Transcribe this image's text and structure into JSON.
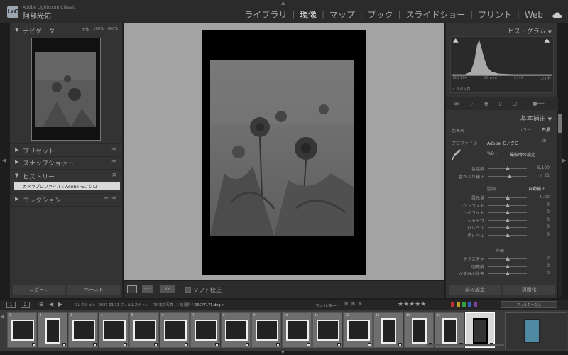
{
  "app": {
    "logo": "LrC",
    "name": "Adobe Lightroom Classic",
    "user": "阿部光佑"
  },
  "modules": [
    {
      "label": "ライブラリ",
      "active": false
    },
    {
      "label": "現像",
      "active": true
    },
    {
      "label": "マップ",
      "active": false
    },
    {
      "label": "ブック",
      "active": false
    },
    {
      "label": "スライドショー",
      "active": false
    },
    {
      "label": "プリント",
      "active": false
    },
    {
      "label": "Web",
      "active": false
    }
  ],
  "module_separator": "|",
  "left_panel": {
    "navigator": {
      "title": "ナビゲーター",
      "zoom_fit": "全体",
      "zoom_fill": "100%",
      "zoom_custom": "800%"
    },
    "presets": {
      "title": "プリセット",
      "action": "+"
    },
    "snapshots": {
      "title": "スナップショット",
      "action": "+"
    },
    "history": {
      "title": "ヒストリー",
      "action": "×",
      "items": [
        "カメラプロファイル : Adobe モノクロ"
      ]
    },
    "collections": {
      "title": "コレクション",
      "action": "− +"
    },
    "copy_label": "コピー...",
    "paste_label": "ペースト"
  },
  "toolbar": {
    "before_after": "▭▭",
    "yy": "YY",
    "softproof_label": "ソフト校正"
  },
  "right_panel": {
    "histogram_title": "ヒストグラム",
    "hist_meta": [
      "ISO 100",
      "90 mm",
      "f / 16",
      "1/5 秒"
    ],
    "original_photo": "元の写真",
    "basic_title": "基本補正",
    "treatment_label": "色表現",
    "treatment_color": "カラー",
    "treatment_bw": "白黒",
    "profile_label": "プロファイル",
    "profile_value": "Adobe モノクロ",
    "wb_label": "WB :",
    "wb_value": "撮影時の設定",
    "sliders_wb": [
      {
        "label": "色温度",
        "value": "5,100",
        "pos": 0.5
      },
      {
        "label": "色かぶり補正",
        "value": "+ 21",
        "pos": 0.55
      }
    ],
    "tone_label": "階調",
    "auto_tone": "自動補正",
    "sliders_tone": [
      {
        "label": "露光量",
        "value": "0.00",
        "pos": 0.5
      },
      {
        "label": "コントラスト",
        "value": "0",
        "pos": 0.5
      },
      {
        "label": "ハイライト",
        "value": "0",
        "pos": 0.5
      },
      {
        "label": "シャドウ",
        "value": "0",
        "pos": 0.5
      },
      {
        "label": "白レベル",
        "value": "0",
        "pos": 0.5
      },
      {
        "label": "黒レベル",
        "value": "0",
        "pos": 0.5
      }
    ],
    "presence_label": "外観",
    "sliders_presence": [
      {
        "label": "テクスチャ",
        "value": "0",
        "pos": 0.5
      },
      {
        "label": "明瞭度",
        "value": "0",
        "pos": 0.5
      },
      {
        "label": "かすみの除去",
        "value": "0",
        "pos": 0.5
      }
    ],
    "prev_label": "前の設定",
    "reset_label": "初期化"
  },
  "filmstrip": {
    "pages": [
      "1",
      "2"
    ],
    "path": "コレクション : 2021-03-21 フィルムスキャン",
    "count": "75 枚の写真 / 1 枚選択 /",
    "filename": "DSCF7171.dng",
    "filter_label": "フィルター :",
    "filter_value": "フィルターなし",
    "label_colors": [
      "#c03030",
      "#c0a020",
      "#30a040",
      "#3060c0",
      "#8040a0"
    ],
    "cells": [
      {
        "num": "1",
        "orient": "landscape"
      },
      {
        "num": "2",
        "orient": "portrait"
      },
      {
        "num": "3",
        "orient": "landscape"
      },
      {
        "num": "4",
        "orient": "landscape"
      },
      {
        "num": "5",
        "orient": "landscape"
      },
      {
        "num": "6",
        "orient": "landscape"
      },
      {
        "num": "7",
        "orient": "landscape"
      },
      {
        "num": "8",
        "orient": "landscape"
      },
      {
        "num": "9",
        "orient": "landscape"
      },
      {
        "num": "10",
        "orient": "landscape"
      },
      {
        "num": "11",
        "orient": "landscape"
      },
      {
        "num": "12",
        "orient": "landscape"
      },
      {
        "num": "13",
        "orient": "portrait"
      },
      {
        "num": "14",
        "orient": "portrait"
      },
      {
        "num": "15",
        "orient": "portrait"
      },
      {
        "num": "16",
        "orient": "portrait"
      }
    ]
  }
}
